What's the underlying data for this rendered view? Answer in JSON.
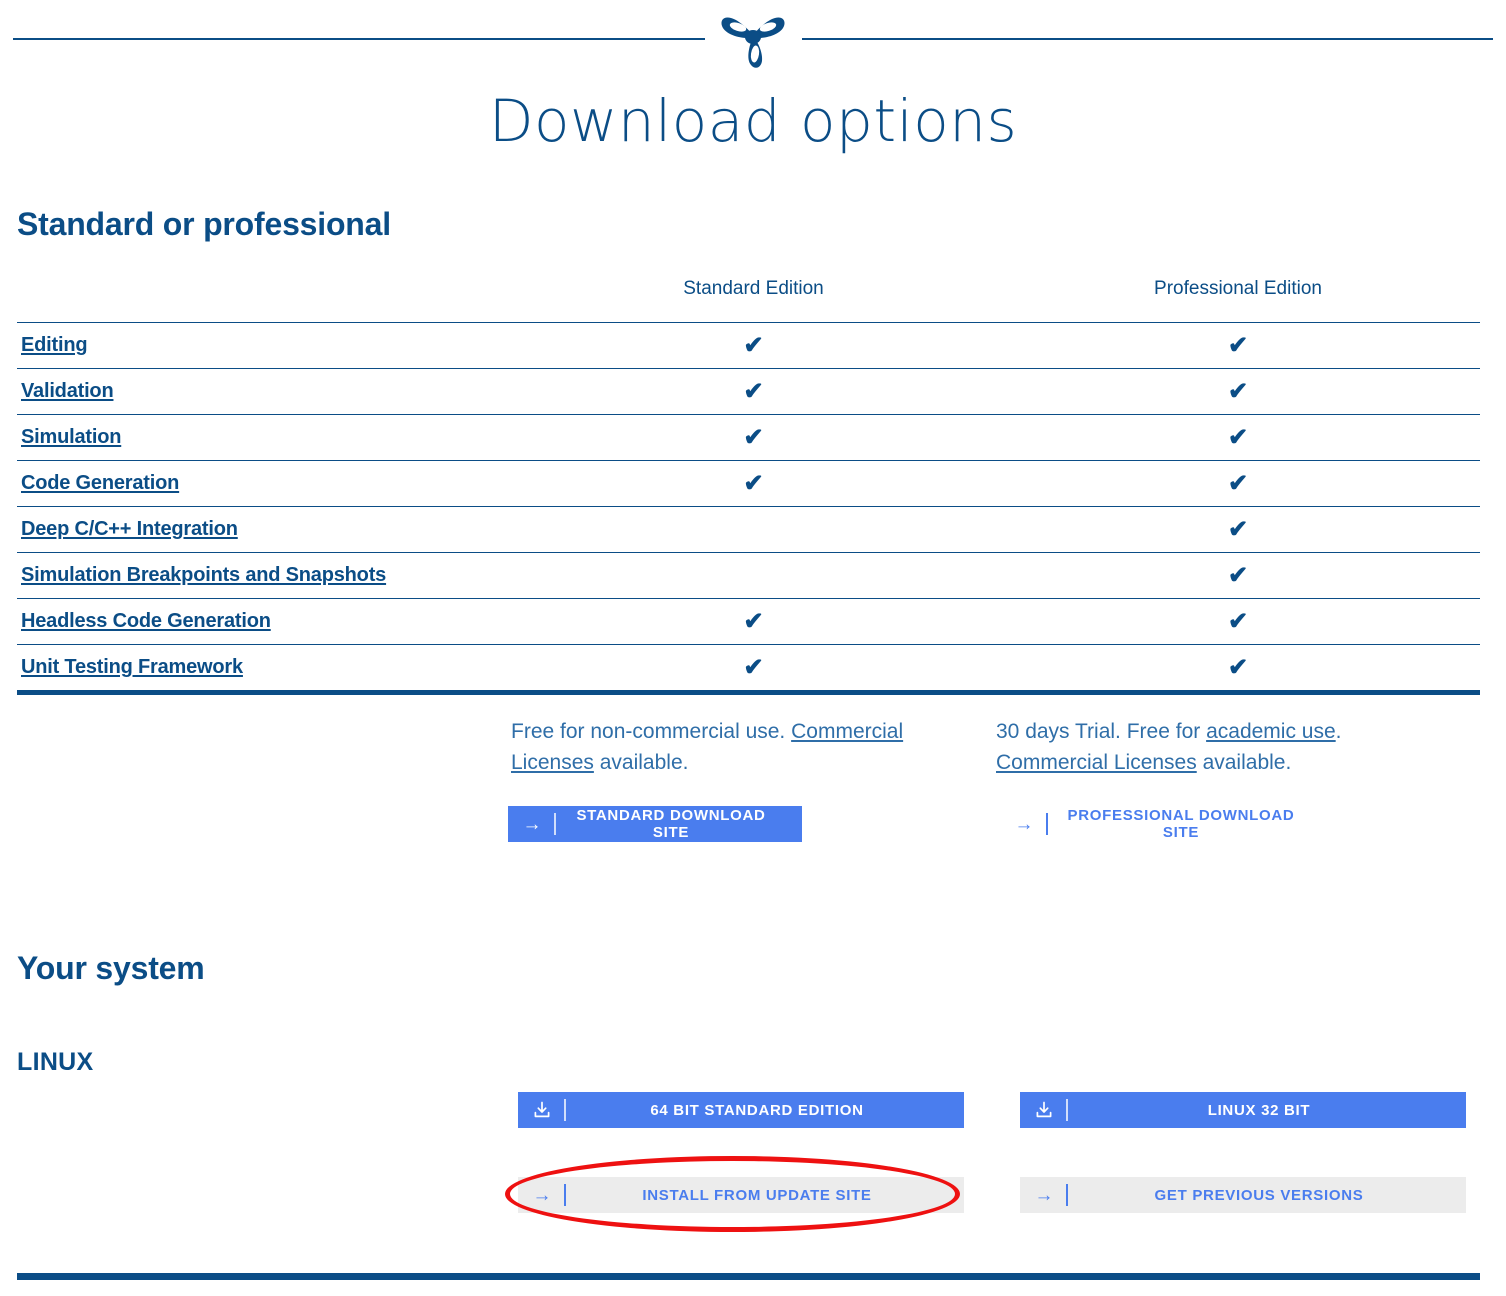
{
  "header": {
    "logo_icon": "trefoil-logo-icon",
    "rule_color": "#0b4d86"
  },
  "page_title": "Download options",
  "sections": {
    "comparison_heading": "Standard or professional",
    "system_heading": "Your system",
    "os_label": "LINUX"
  },
  "comparison_table": {
    "columns": [
      "",
      "Standard Edition",
      "Professional Edition"
    ],
    "rows": [
      {
        "feature": "Editing",
        "standard": true,
        "professional": true
      },
      {
        "feature": "Validation",
        "standard": true,
        "professional": true
      },
      {
        "feature": "Simulation",
        "standard": true,
        "professional": true
      },
      {
        "feature": "Code Generation",
        "standard": true,
        "professional": true
      },
      {
        "feature": "Deep C/C++ Integration",
        "standard": false,
        "professional": true
      },
      {
        "feature": "Simulation Breakpoints and Snapshots",
        "standard": false,
        "professional": true
      },
      {
        "feature": "Headless Code Generation",
        "standard": true,
        "professional": true
      },
      {
        "feature": "Unit Testing Framework",
        "standard": true,
        "professional": true
      }
    ],
    "check_glyph": "✔"
  },
  "license": {
    "standard": {
      "part1": "Free for non-commercial use. ",
      "link1": "Commercial Licenses",
      "part2": " available."
    },
    "professional": {
      "part1": "30 days Trial. Free for ",
      "link1": "academic use",
      "part2": ". ",
      "link2": "Commercial Licenses",
      "part3": " available."
    }
  },
  "cta_buttons": {
    "standard_site": {
      "label": "STANDARD DOWNLOAD SITE",
      "icon": "arrow-right-icon",
      "arrow": "→"
    },
    "professional_site": {
      "label": "PROFESSIONAL DOWNLOAD SITE",
      "icon": "arrow-right-icon",
      "arrow": "→"
    }
  },
  "download_buttons": [
    {
      "label": "64 BIT STANDARD EDITION",
      "icon": "download-icon",
      "style": "solid"
    },
    {
      "label": "LINUX 32 BIT",
      "icon": "download-icon",
      "style": "solid"
    },
    {
      "label": "INSTALL FROM UPDATE SITE",
      "icon": "arrow-right-icon",
      "arrow": "→",
      "style": "grey"
    },
    {
      "label": "GET PREVIOUS VERSIONS",
      "icon": "arrow-right-icon",
      "arrow": "→",
      "style": "grey"
    }
  ],
  "annotation": {
    "shape": "ellipse",
    "color": "#ee1111",
    "targets": "INSTALL FROM UPDATE SITE"
  },
  "colors": {
    "brand_dark_blue": "#0b4d86",
    "link_blue": "#2f6ea8",
    "button_blue": "#4a7dee",
    "grey_button": "#ececec",
    "annotation_red": "#ee1111"
  }
}
